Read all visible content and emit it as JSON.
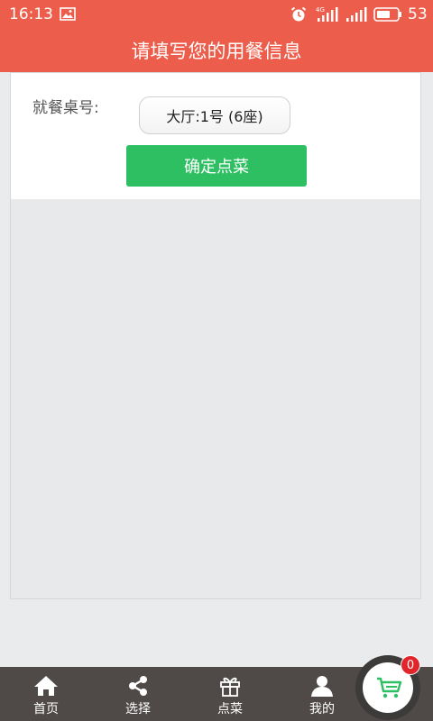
{
  "status_bar": {
    "time": "16:13",
    "battery": "53",
    "icons": [
      "image-icon",
      "alarm-icon",
      "signal-4g-icon",
      "signal-icon",
      "battery-icon"
    ]
  },
  "header": {
    "title": "请填写您的用餐信息"
  },
  "form": {
    "table_label": "就餐桌号:",
    "table_value": "大厅:1号 (6座)",
    "confirm_label": "确定点菜"
  },
  "nav": {
    "items": [
      {
        "label": "首页",
        "icon": "home-icon"
      },
      {
        "label": "选择",
        "icon": "share-icon"
      },
      {
        "label": "点菜",
        "icon": "gift-icon"
      },
      {
        "label": "我的",
        "icon": "user-icon"
      }
    ]
  },
  "cart": {
    "count": "0",
    "icon": "cart-icon"
  },
  "colors": {
    "accent": "#ec5e4b",
    "confirm": "#2fbf63",
    "nav_bg": "#4f4a48",
    "badge": "#e0262a"
  }
}
